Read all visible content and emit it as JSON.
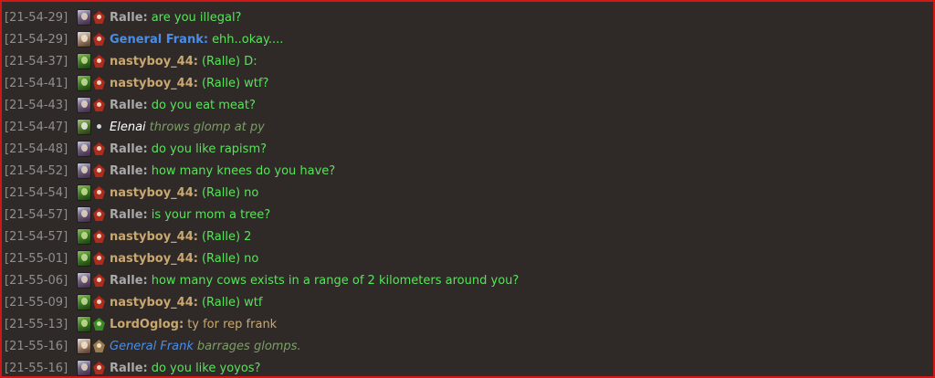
{
  "colors": {
    "timestamp": "#8f8f8f",
    "message": "#59e25c",
    "emote": "#7e9c6a",
    "border": "#d01818",
    "background": "#2f2a28"
  },
  "messages": [
    {
      "ts": "[21-54-29]",
      "user": "Ralle",
      "name_color": "#a9a9a9",
      "text": "are you illegal?",
      "text_color": "#59e25c",
      "avatar": "undead-portrait-icon",
      "class_badge": "red-class-icon",
      "emote": false
    },
    {
      "ts": "[21-54-29]",
      "user": "General Frank",
      "name_color": "#4a8de6",
      "text": "ehh..okay....",
      "text_color": "#59e25c",
      "avatar": "human-portrait-icon",
      "class_badge": "red-class-icon",
      "emote": false
    },
    {
      "ts": "[21-54-37]",
      "user": "nastyboy_44",
      "name_color": "#c8a870",
      "text": "(Ralle) D:",
      "text_color": "#59e25c",
      "avatar": "orc-portrait-icon",
      "class_badge": "red-class-icon",
      "emote": false
    },
    {
      "ts": "[21-54-41]",
      "user": "nastyboy_44",
      "name_color": "#c8a870",
      "text": "(Ralle) wtf?",
      "text_color": "#59e25c",
      "avatar": "orc-portrait-icon",
      "class_badge": "red-class-icon",
      "emote": false
    },
    {
      "ts": "[21-54-43]",
      "user": "Ralle",
      "name_color": "#a9a9a9",
      "text": "do you eat meat?",
      "text_color": "#59e25c",
      "avatar": "undead-portrait-icon",
      "class_badge": "red-class-icon",
      "emote": false
    },
    {
      "ts": "[21-54-47]",
      "user": "Elenai",
      "name_color": "#ffffff",
      "text": "throws glomp at py",
      "text_color": "#7e9c6a",
      "avatar": "elf-portrait-icon",
      "class_badge": "dark-class-icon",
      "emote": true
    },
    {
      "ts": "[21-54-48]",
      "user": "Ralle",
      "name_color": "#a9a9a9",
      "text": "do you like rapism?",
      "text_color": "#59e25c",
      "avatar": "undead-portrait-icon",
      "class_badge": "red-class-icon",
      "emote": false
    },
    {
      "ts": "[21-54-52]",
      "user": "Ralle",
      "name_color": "#a9a9a9",
      "text": "how many knees do you have?",
      "text_color": "#59e25c",
      "avatar": "undead-portrait-icon",
      "class_badge": "red-class-icon",
      "emote": false
    },
    {
      "ts": "[21-54-54]",
      "user": "nastyboy_44",
      "name_color": "#c8a870",
      "text": "(Ralle) no",
      "text_color": "#59e25c",
      "avatar": "orc-portrait-icon",
      "class_badge": "red-class-icon",
      "emote": false
    },
    {
      "ts": "[21-54-57]",
      "user": "Ralle",
      "name_color": "#a9a9a9",
      "text": "is your mom a tree?",
      "text_color": "#59e25c",
      "avatar": "undead-portrait-icon",
      "class_badge": "red-class-icon",
      "emote": false
    },
    {
      "ts": "[21-54-57]",
      "user": "nastyboy_44",
      "name_color": "#c8a870",
      "text": "(Ralle) 2",
      "text_color": "#59e25c",
      "avatar": "orc-portrait-icon",
      "class_badge": "red-class-icon",
      "emote": false
    },
    {
      "ts": "[21-55-01]",
      "user": "nastyboy_44",
      "name_color": "#c8a870",
      "text": "(Ralle) no",
      "text_color": "#59e25c",
      "avatar": "orc-portrait-icon",
      "class_badge": "red-class-icon",
      "emote": false
    },
    {
      "ts": "[21-55-06]",
      "user": "Ralle",
      "name_color": "#a9a9a9",
      "text": "how many cows exists in a range of 2 kilometers around you?",
      "text_color": "#59e25c",
      "avatar": "undead-portrait-icon",
      "class_badge": "red-class-icon",
      "emote": false
    },
    {
      "ts": "[21-55-09]",
      "user": "nastyboy_44",
      "name_color": "#c8a870",
      "text": "(Ralle) wtf",
      "text_color": "#59e25c",
      "avatar": "orc-portrait-icon",
      "class_badge": "red-class-icon",
      "emote": false
    },
    {
      "ts": "[21-55-13]",
      "user": "LordOglog",
      "name_color": "#c8a870",
      "text": "ty for rep frank",
      "text_color": "#c8a870",
      "avatar": "orc-portrait-icon",
      "class_badge": "green-class-icon",
      "emote": false
    },
    {
      "ts": "[21-55-16]",
      "user": "General Frank",
      "name_color": "#4a8de6",
      "text": "barrages glomps.",
      "text_color": "#7e9c6a",
      "avatar": "human-portrait-icon",
      "class_badge": "tan-class-icon",
      "emote": true
    },
    {
      "ts": "[21-55-16]",
      "user": "Ralle",
      "name_color": "#a9a9a9",
      "text": "do you like yoyos?",
      "text_color": "#59e25c",
      "avatar": "undead-portrait-icon",
      "class_badge": "red-class-icon",
      "emote": false
    }
  ]
}
